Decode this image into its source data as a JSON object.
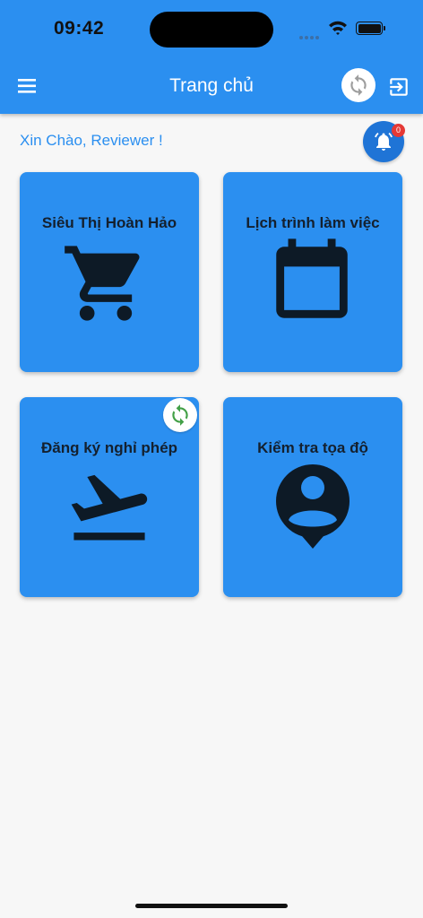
{
  "status_bar": {
    "time": "09:42"
  },
  "header": {
    "title": "Trang chủ",
    "menu_icon": "menu-icon",
    "sync_icon": "sync-icon",
    "logout_icon": "logout-icon",
    "accent": "#2b8ff0"
  },
  "greeting": "Xin Chào, Reviewer !",
  "notifications": {
    "count": "0",
    "icon": "bell-icon"
  },
  "tiles": [
    {
      "label": "Siêu Thị Hoàn Hảo",
      "icon": "cart-icon"
    },
    {
      "label": "Lịch trình làm việc",
      "icon": "calendar-icon"
    },
    {
      "label": "Đăng ký nghỉ phép",
      "icon": "flight-takeoff-icon"
    },
    {
      "label": "Kiểm tra tọa độ",
      "icon": "person-pin-icon"
    }
  ],
  "colors": {
    "tile": "#2b8ff0",
    "icon_dark": "#0d1a26",
    "sync_green": "#43a047",
    "badge": "#e53935"
  }
}
